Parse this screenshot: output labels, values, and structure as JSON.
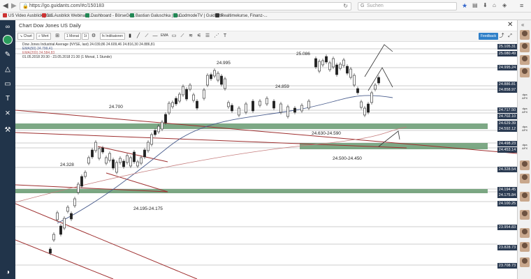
{
  "browser": {
    "url": "https://go.guidants.com/#c/150183",
    "search_placeholder": "Suchen"
  },
  "bookmarks": [
    {
      "label": "US Video Ausblick | Gu..."
    },
    {
      "label": "US Ausblick Webinar |..."
    },
    {
      "label": "Dashboard - BörseGo..."
    },
    {
      "label": "Bastian Galuschka | Gu..."
    },
    {
      "label": "GodmodeTV | Guidants"
    },
    {
      "label": "Realtimekurse, Finanz-..."
    }
  ],
  "window": {
    "title": "Chart Dow Jones US Daily",
    "feedback_label": "Feedback"
  },
  "toolbar": {
    "chart_label": "Chart",
    "wert_label": "Wert",
    "interval_1monat": "1 Monat",
    "interval_1t": "1t",
    "indicators_label": "Indikatoren",
    "ema_label": "EMA"
  },
  "chart_info": {
    "line1": "Dow Jones Industrial Average (NYSE, last)  24.039,86   24.609,46   24.816,30   24.886,81",
    "line2": "EMA(50)  24.799,41",
    "line3": "EMA(200)  24.584,83",
    "line4": "01.05.2018 20:30 - 23.05.2018 21:30   (1 Monat, 1 Stunde)"
  },
  "chart_data": {
    "type": "line",
    "title": "Chart Dow Jones US Daily",
    "ylim": [
      23650,
      25150
    ],
    "annotations": [
      "25.086",
      "24.995",
      "24.859",
      "24.700",
      "24.630-24.590",
      "24.500-24.450",
      "24.328",
      "24.195-24.175"
    ],
    "price_levels": [
      "25.105.31",
      "25.080.49",
      "24.995.24",
      "24.886.81",
      "24.858.97",
      "24.717.50",
      "24.702.10",
      "24.629.39",
      "24.592.12",
      "24.498.23",
      "24.453.14",
      "24.328.54",
      "24.194.45",
      "24.175.84",
      "24.100.25",
      "23.954.83",
      "23.828.73",
      "23.708.73"
    ]
  }
}
